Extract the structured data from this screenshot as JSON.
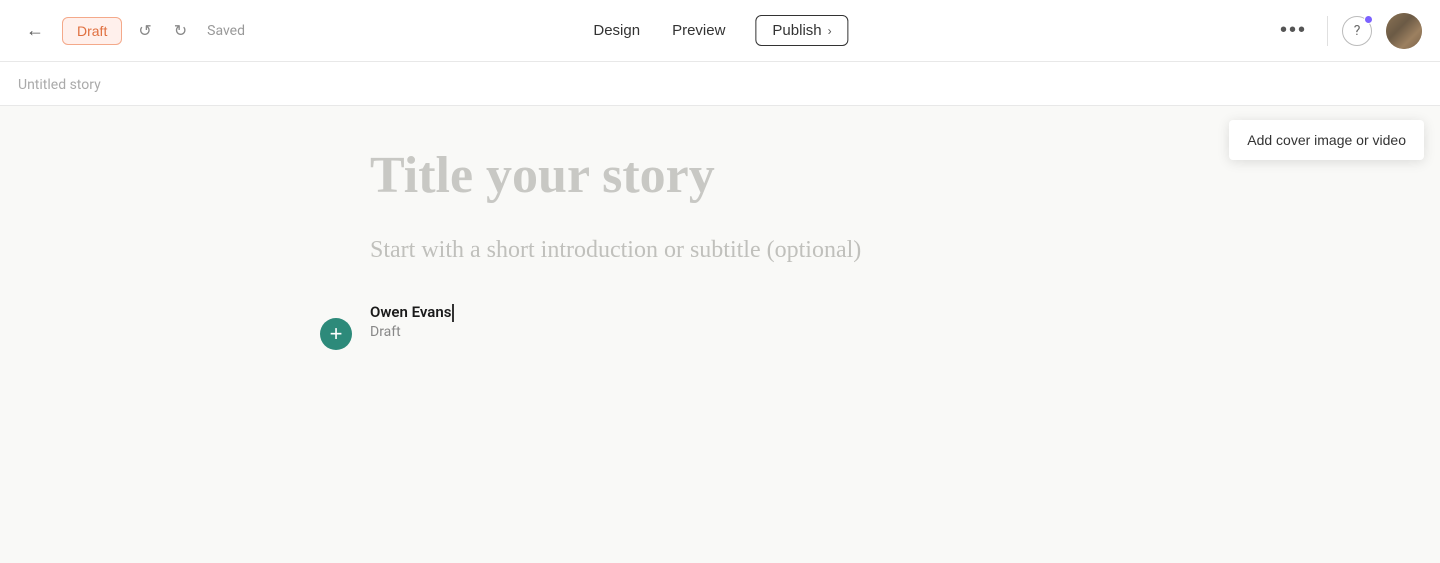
{
  "topbar": {
    "back_icon": "←",
    "draft_label": "Draft",
    "undo_icon": "↺",
    "redo_icon": "↻",
    "saved_label": "Saved",
    "design_label": "Design",
    "preview_label": "Preview",
    "publish_label": "Publish",
    "publish_chevron": "›",
    "more_icon": "•••",
    "help_icon": "?",
    "story_title": "Untitled story"
  },
  "editor": {
    "title_placeholder": "Title your story",
    "subtitle_placeholder": "Start with a short introduction or subtitle (optional)",
    "author_name": "Owen Evans",
    "author_status": "Draft",
    "add_cover_label": "Add cover image or video",
    "plus_icon": "+"
  }
}
